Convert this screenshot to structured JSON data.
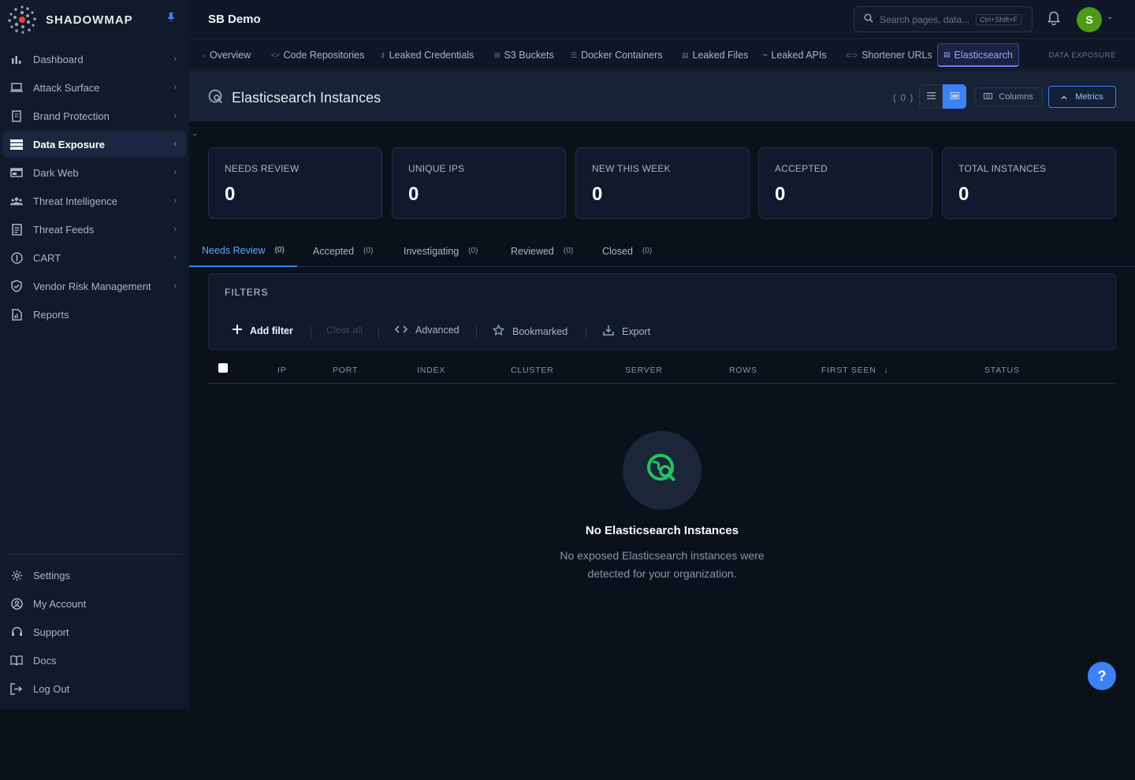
{
  "brand": {
    "name": "SHADOWMAP"
  },
  "sidebar": {
    "items": [
      {
        "label": "Dashboard",
        "icon": "bar-chart-icon"
      },
      {
        "label": "Attack Surface",
        "icon": "laptop-icon"
      },
      {
        "label": "Brand Protection",
        "icon": "building-icon"
      },
      {
        "label": "Data Exposure",
        "icon": "database-icon"
      },
      {
        "label": "Dark Web",
        "icon": "window-icon"
      },
      {
        "label": "Threat Intelligence",
        "icon": "people-icon"
      },
      {
        "label": "Threat Feeds",
        "icon": "document-icon"
      },
      {
        "label": "CART",
        "icon": "info-icon"
      },
      {
        "label": "Vendor Risk Management",
        "icon": "shield-check-icon"
      },
      {
        "label": "Reports",
        "icon": "report-icon"
      }
    ],
    "bottom": [
      {
        "label": "Settings",
        "icon": "gear-icon"
      },
      {
        "label": "My Account",
        "icon": "user-circle-icon"
      },
      {
        "label": "Support",
        "icon": "headset-icon"
      },
      {
        "label": "Docs",
        "icon": "book-icon"
      },
      {
        "label": "Log Out",
        "icon": "logout-icon"
      }
    ]
  },
  "header": {
    "org": "SB Demo",
    "search_placeholder": "Search pages, data...",
    "search_shortcut": "Ctrl+Shift+F",
    "avatar_initial": "S"
  },
  "subtabs": {
    "items": [
      "Overview",
      "Code Repositories",
      "Leaked Credentials",
      "S3 Buckets",
      "Docker Containers",
      "Leaked Files",
      "Leaked APIs",
      "Shortener URLs",
      "Elasticsearch"
    ],
    "section": "DATA EXPOSURE"
  },
  "page": {
    "title": "Elasticsearch Instances",
    "count": "( 0 )",
    "columns_label": "Columns",
    "metrics_label": "Metrics"
  },
  "stats": [
    {
      "label": "NEEDS REVIEW",
      "value": "0"
    },
    {
      "label": "UNIQUE IPS",
      "value": "0"
    },
    {
      "label": "NEW THIS WEEK",
      "value": "0"
    },
    {
      "label": "ACCEPTED",
      "value": "0"
    },
    {
      "label": "TOTAL INSTANCES",
      "value": "0"
    }
  ],
  "status_tabs": [
    {
      "label": "Needs Review",
      "count": "(0)"
    },
    {
      "label": "Accepted",
      "count": "(0)"
    },
    {
      "label": "Investigating",
      "count": "(0)"
    },
    {
      "label": "Reviewed",
      "count": "(0)"
    },
    {
      "label": "Closed",
      "count": "(0)"
    }
  ],
  "filters": {
    "title": "FILTERS",
    "add": "Add filter",
    "clear": "Clear all",
    "advanced": "Advanced",
    "bookmarked": "Bookmarked",
    "export": "Export"
  },
  "table": {
    "columns": [
      "IP",
      "PORT",
      "INDEX",
      "CLUSTER",
      "SERVER",
      "ROWS",
      "FIRST SEEN",
      "STATUS"
    ]
  },
  "empty": {
    "title": "No Elasticsearch Instances",
    "line1": "No exposed Elasticsearch instances were",
    "line2": "detected for your organization."
  },
  "help": "?",
  "colors": {
    "accent": "#3b82f6",
    "brand_green": "#22c55e",
    "avatar": "#4d9a1b"
  }
}
